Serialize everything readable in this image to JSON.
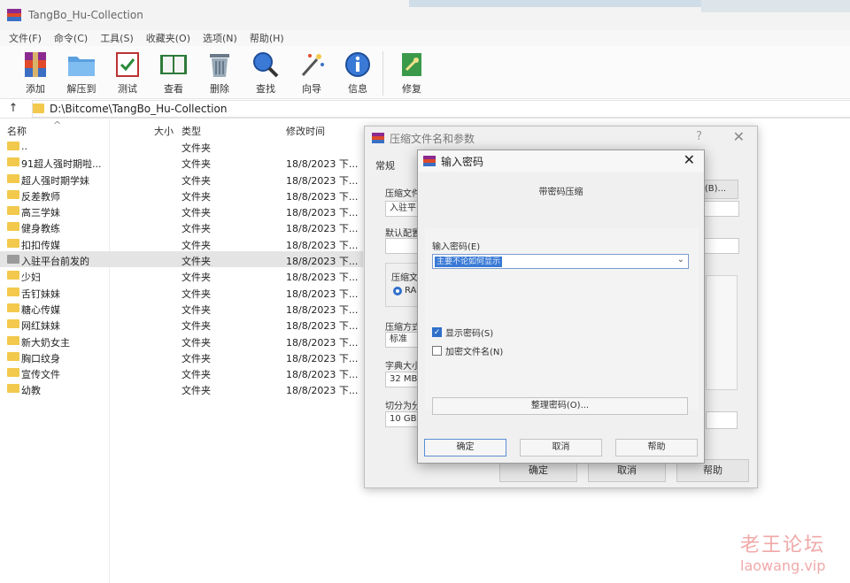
{
  "window": {
    "title": "TangBo_Hu-Collection"
  },
  "menu": [
    "文件(F)",
    "命令(C)",
    "工具(S)",
    "收藏夹(O)",
    "选项(N)",
    "帮助(H)"
  ],
  "toolbar": [
    {
      "label": "添加",
      "icon": "add-archive-icon"
    },
    {
      "label": "解压到",
      "icon": "extract-folder-icon"
    },
    {
      "label": "测试",
      "icon": "test-checklist-icon"
    },
    {
      "label": "查看",
      "icon": "view-book-icon"
    },
    {
      "label": "删除",
      "icon": "trash-icon"
    },
    {
      "label": "查找",
      "icon": "magnifier-icon"
    },
    {
      "label": "向导",
      "icon": "wizard-wand-icon"
    },
    {
      "label": "信息",
      "icon": "info-icon"
    },
    {
      "label": "修复",
      "icon": "repair-icon"
    }
  ],
  "address": {
    "up": "↑",
    "path": "D:\\Bitcome\\TangBo_Hu-Collection"
  },
  "columns": {
    "name": "名称",
    "size": "大小",
    "type": "类型",
    "modified": "修改时间",
    "sort_arrow": "^"
  },
  "files": [
    {
      "name": "..",
      "type": "文件夹",
      "date": ""
    },
    {
      "name": "91超人强时期啦...",
      "type": "文件夹",
      "date": "18/8/2023 下..."
    },
    {
      "name": "超人强时期学妹",
      "type": "文件夹",
      "date": "18/8/2023 下..."
    },
    {
      "name": "反差教师",
      "type": "文件夹",
      "date": "18/8/2023 下..."
    },
    {
      "name": "高三学妹",
      "type": "文件夹",
      "date": "18/8/2023 下..."
    },
    {
      "name": "健身教练",
      "type": "文件夹",
      "date": "18/8/2023 下..."
    },
    {
      "name": "扣扣传媒",
      "type": "文件夹",
      "date": "18/8/2023 下..."
    },
    {
      "name": "入驻平台前发的",
      "type": "文件夹",
      "date": "18/8/2023 下..."
    },
    {
      "name": "少妇",
      "type": "文件夹",
      "date": "18/8/2023 下..."
    },
    {
      "name": "舌钉妹妹",
      "type": "文件夹",
      "date": "18/8/2023 下..."
    },
    {
      "name": "糖心传媒",
      "type": "文件夹",
      "date": "18/8/2023 下..."
    },
    {
      "name": "网红妹妹",
      "type": "文件夹",
      "date": "18/8/2023 下..."
    },
    {
      "name": "新大奶女主",
      "type": "文件夹",
      "date": "18/8/2023 下..."
    },
    {
      "name": "胸口纹身",
      "type": "文件夹",
      "date": "18/8/2023 下..."
    },
    {
      "name": "宣传文件",
      "type": "文件夹",
      "date": "18/8/2023 下..."
    },
    {
      "name": "幼教",
      "type": "文件夹",
      "date": "18/8/2023 下..."
    }
  ],
  "params_dialog": {
    "title": "压缩文件名和参数",
    "help": "?",
    "close": "✕",
    "tab_general": "常规",
    "archive_name_label": "压缩文件",
    "archive_name_value": "入驻平",
    "browse_label": "(B)...",
    "profile_label": "默认配置",
    "format_label": "压缩文",
    "format_value": "RA",
    "method_label": "压缩方式",
    "method_value": "标准",
    "dict_label": "字典大小",
    "dict_value": "32 MB",
    "split_label": "切分为分",
    "split_value": "10 GB",
    "ok": "确定",
    "cancel": "取消",
    "help_btn": "帮助"
  },
  "password_dialog": {
    "title": "输入密码",
    "close": "✕",
    "subtitle": "带密码压缩",
    "enter_label": "输入密码(E)",
    "password_value": "主要不论如何显示",
    "show_password": "显示密码(S)",
    "encrypt_names": "加密文件名(N)",
    "organize": "整理密码(O)...",
    "ok": "确定",
    "cancel": "取消",
    "help": "帮助"
  },
  "watermark": {
    "line1": "老王论坛",
    "line2": "laowang.vip"
  },
  "colors": {
    "folder": "#f2c94c",
    "accent": "#2f6fc9",
    "watermark": "#f0a9a9"
  }
}
